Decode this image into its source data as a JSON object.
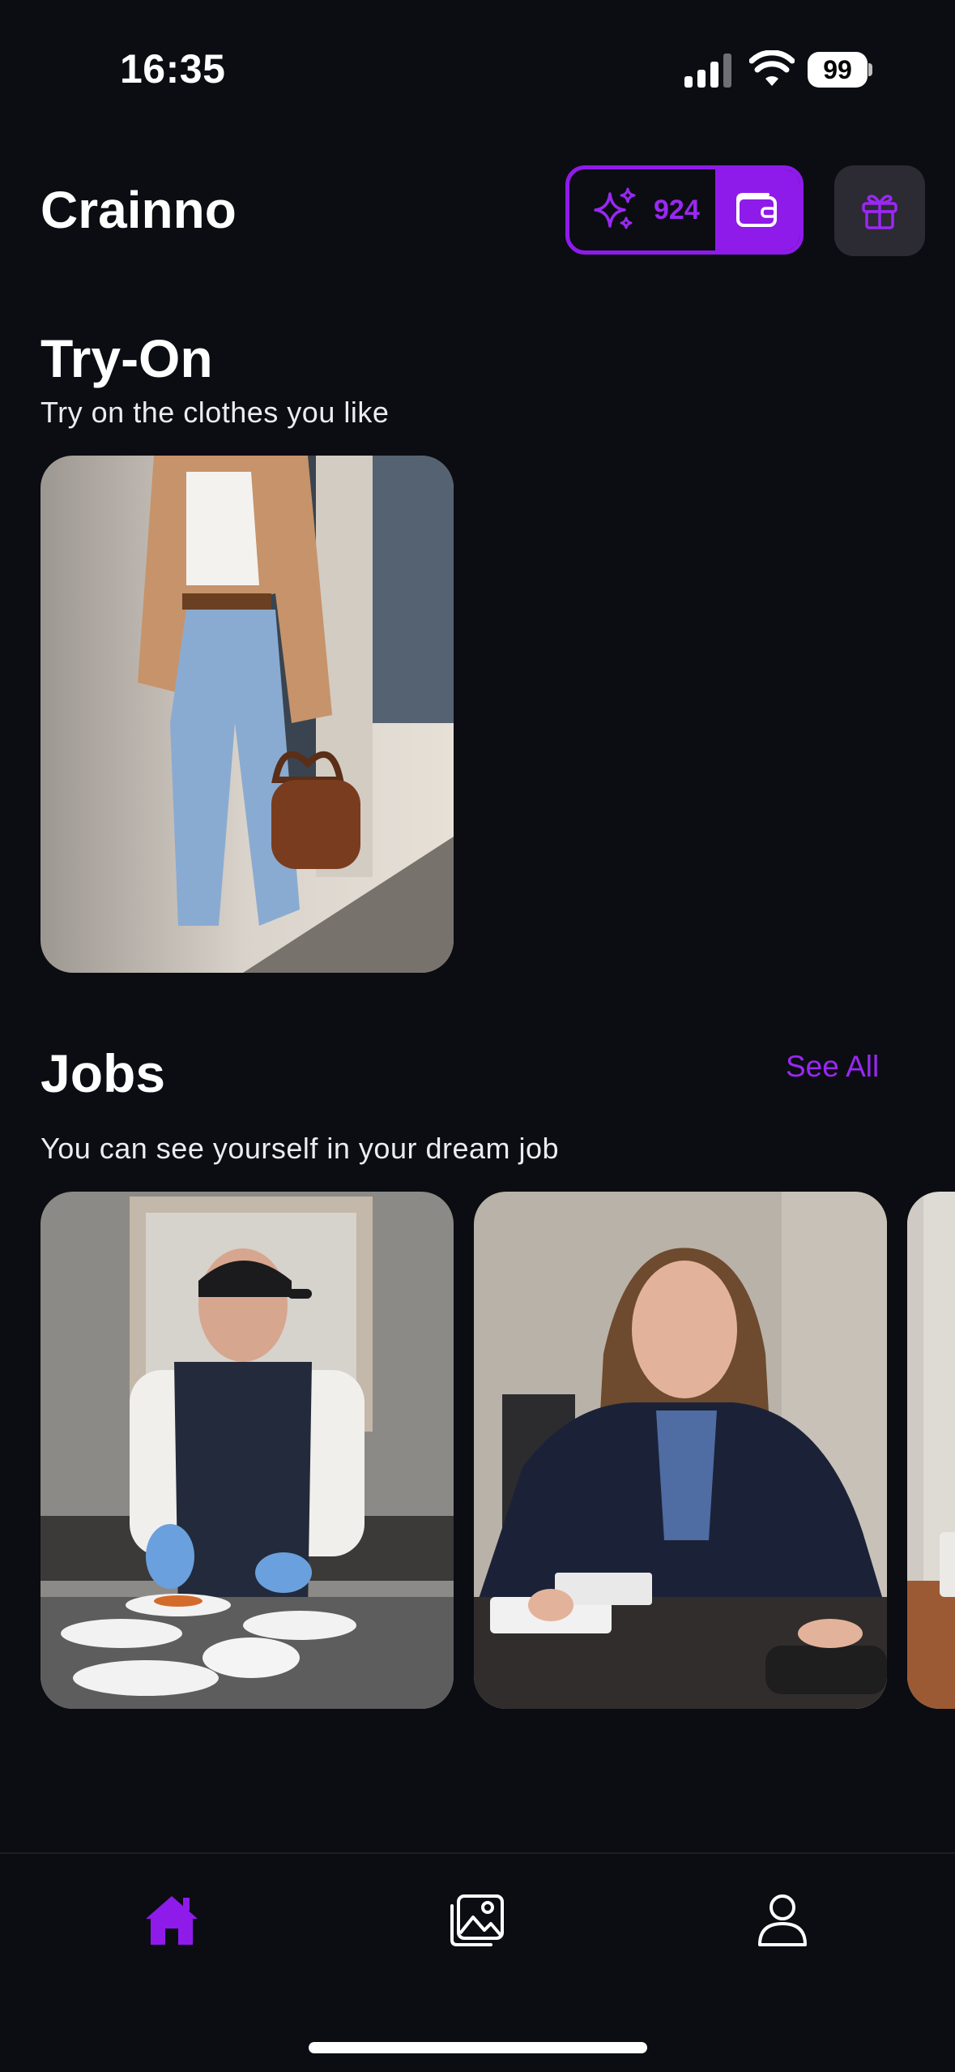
{
  "status_bar": {
    "time": "16:35",
    "battery": "99"
  },
  "header": {
    "title": "Crainno",
    "credits": "924"
  },
  "try_on": {
    "title": "Try-On",
    "subtitle": "Try on the clothes you like"
  },
  "jobs": {
    "title": "Jobs",
    "see_all": "See All",
    "subtitle": "You can see yourself in your dream job"
  },
  "icons": {
    "sparkle": "sparkles-icon",
    "wallet": "wallet-icon",
    "gift": "gift-icon",
    "home": "home-icon",
    "gallery": "gallery-icon",
    "profile": "profile-icon"
  },
  "colors": {
    "accent": "#8f1bea",
    "background": "#0b0d13"
  }
}
